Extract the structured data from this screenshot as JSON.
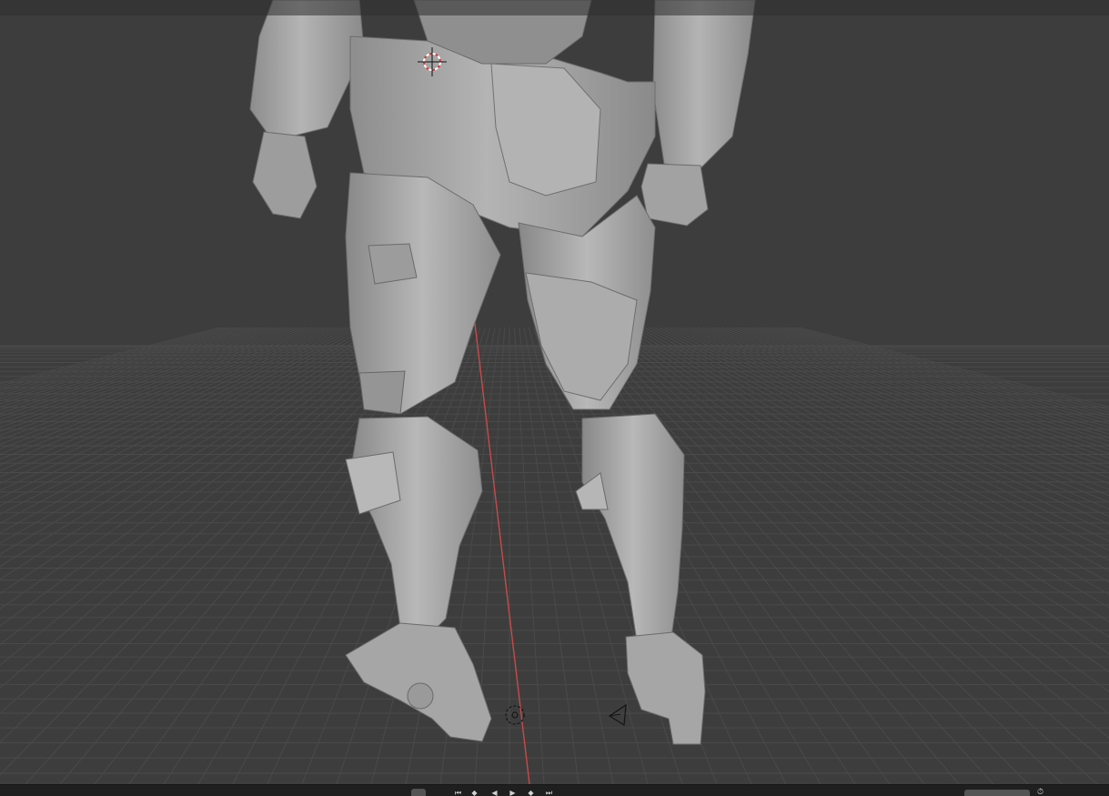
{
  "app": "Blender",
  "viewport": {
    "background_color": "#3d3d3d",
    "grid_color": "#4a4a4a",
    "x_axis_color": "#c84a4a",
    "model_color": "#a9a9a9",
    "model_shadow_color": "#7c7c7c",
    "model_highlight_color": "#c7c7c7",
    "object": "armored-robot-mesh"
  },
  "timeline": {
    "frame_icon": "frame-field-icon",
    "playback_icons": [
      "jump-to-start-icon",
      "previous-keyframe-icon",
      "play-reverse-icon",
      "play-icon",
      "next-keyframe-icon",
      "jump-to-end-icon"
    ],
    "stopwatch_icon": "stopwatch-icon"
  }
}
